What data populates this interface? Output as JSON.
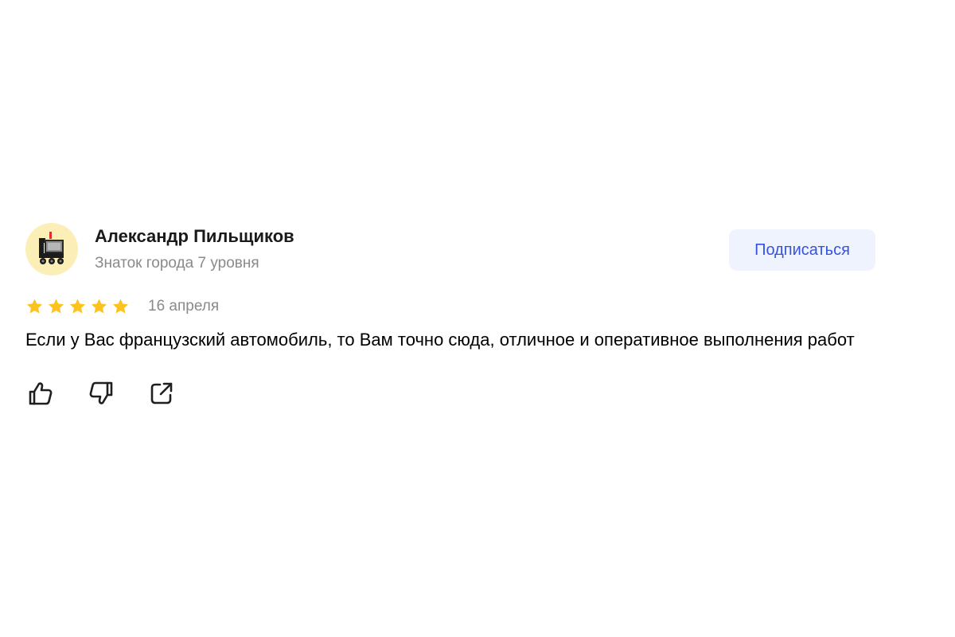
{
  "author": {
    "name": "Александр Пильщиков",
    "level": "Знаток города 7 уровня",
    "avatar_icon": "steam-locomotive-icon"
  },
  "subscribe": {
    "label": "Подписаться"
  },
  "rating": {
    "value": 5,
    "max": 5,
    "color": "#fcc31e"
  },
  "date": "16 апреля",
  "review_text": "Если у Вас французский автомобиль, то Вам точно сюда, отличное и оперативное выполнения работ",
  "actions": [
    {
      "icon": "thumbs-up-icon"
    },
    {
      "icon": "thumbs-down-icon"
    },
    {
      "icon": "share-icon"
    }
  ],
  "colors": {
    "accent": "#3653e0",
    "button_bg": "#eff3fd",
    "secondary_text": "#8a8a8a",
    "avatar_bg": "#fbefb7"
  }
}
